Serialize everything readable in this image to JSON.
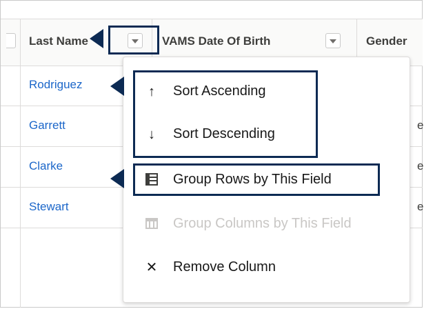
{
  "header": {
    "columns": [
      {
        "label": "Last Name"
      },
      {
        "label": "VAMS Date Of Birth"
      },
      {
        "label": "Gender"
      }
    ]
  },
  "rows": [
    {
      "last_name": "Rodriguez",
      "gender_fragment": ""
    },
    {
      "last_name": "Garrett",
      "gender_fragment": "e"
    },
    {
      "last_name": "Clarke",
      "gender_fragment": "e"
    },
    {
      "last_name": "Stewart",
      "gender_fragment": "e"
    }
  ],
  "menu": {
    "items": [
      {
        "label": "Sort Ascending",
        "icon": "arrow-up-icon",
        "enabled": true
      },
      {
        "label": "Sort Descending",
        "icon": "arrow-down-icon",
        "enabled": true
      },
      {
        "label": "Group Rows by This Field",
        "icon": "group-rows-icon",
        "enabled": true
      },
      {
        "label": "Group Columns by This Field",
        "icon": "group-columns-icon",
        "enabled": false
      },
      {
        "label": "Remove Column",
        "icon": "close-icon",
        "enabled": true
      }
    ]
  },
  "colors": {
    "link": "#1b66c9",
    "annotation": "#0c2a53",
    "disabled": "#c9c7c5"
  }
}
